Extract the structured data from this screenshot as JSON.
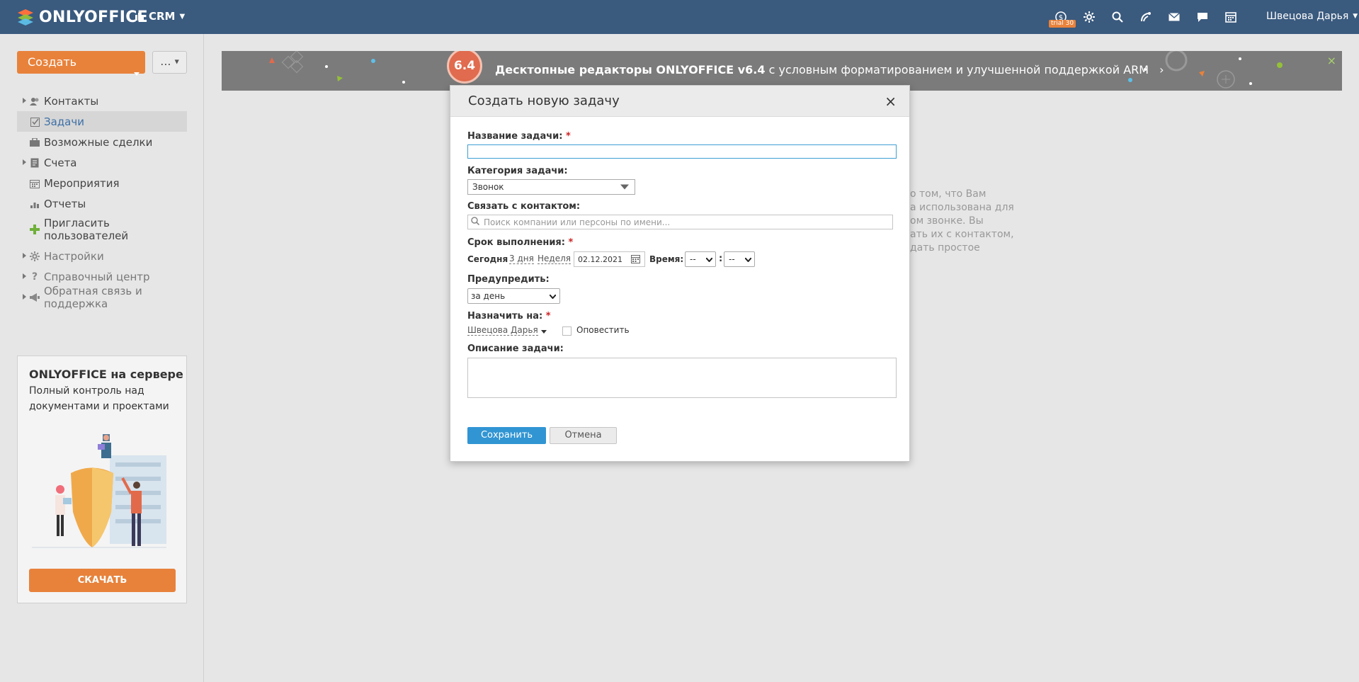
{
  "topbar": {
    "logo": "ONLYOFFICE",
    "module": "CRM",
    "trial_badge": "trial 30",
    "user_name": "Швецова Дарья"
  },
  "sidebar": {
    "create_label": "Создать",
    "more_label": "...",
    "items": [
      {
        "label": "Контакты",
        "icon": "contacts-icon"
      },
      {
        "label": "Задачи",
        "icon": "tasks-icon"
      },
      {
        "label": "Возможные сделки",
        "icon": "deals-icon"
      },
      {
        "label": "Счета",
        "icon": "invoices-icon"
      },
      {
        "label": "Мероприятия",
        "icon": "events-icon"
      },
      {
        "label": "Отчеты",
        "icon": "reports-icon"
      },
      {
        "label": "Пригласить пользователей",
        "icon": "plus-icon"
      },
      {
        "label": "Настройки",
        "icon": "gear-icon"
      },
      {
        "label": "Справочный центр",
        "icon": "question-icon"
      },
      {
        "label": "Обратная связь и поддержка",
        "icon": "megaphone-icon"
      }
    ],
    "promo": {
      "title": "ONLYOFFICE на сервере",
      "subtitle": "Полный контроль над документами и проектами",
      "button": "СКАЧАТЬ"
    }
  },
  "banner": {
    "badge": "6.4",
    "text_bold": "Десктопные редакторы ONLYOFFICE v6.4",
    "text_rest": " с условным форматированием и улучшенной поддержкой ARM",
    "close": "×"
  },
  "background_text": [
    "о том, что Вам",
    "а использована для",
    "ом звонке. Вы",
    "ать их с контактом,",
    "дать простое"
  ],
  "dialog": {
    "title": "Создать новую задачу",
    "close": "×",
    "task_name_label": "Название задачи:",
    "task_name_value": "",
    "category_label": "Категория задачи:",
    "category_value": "Звонок",
    "contact_label": "Связать с контактом:",
    "contact_placeholder": "Поиск компании или персоны по имени...",
    "deadline_label": "Срок выполнения:",
    "today": "Сегодня",
    "three_days": "3 дня",
    "week": "Неделя",
    "date_value": "02.12.2021",
    "time_label": "Время:",
    "hour_value": "--",
    "minute_value": "--",
    "time_sep": ":",
    "alert_label": "Предупредить:",
    "alert_value": "за день",
    "assign_label": "Назначить на:",
    "assignee": "Швецова Дарья",
    "notify_label": "Оповестить",
    "description_label": "Описание задачи:",
    "description_value": "",
    "save": "Сохранить",
    "cancel": "Отмена",
    "required_mark": "*"
  },
  "colors": {
    "topbar": "#3a5a7e",
    "accent_orange": "#e8823b",
    "primary_blue": "#3195d3"
  }
}
